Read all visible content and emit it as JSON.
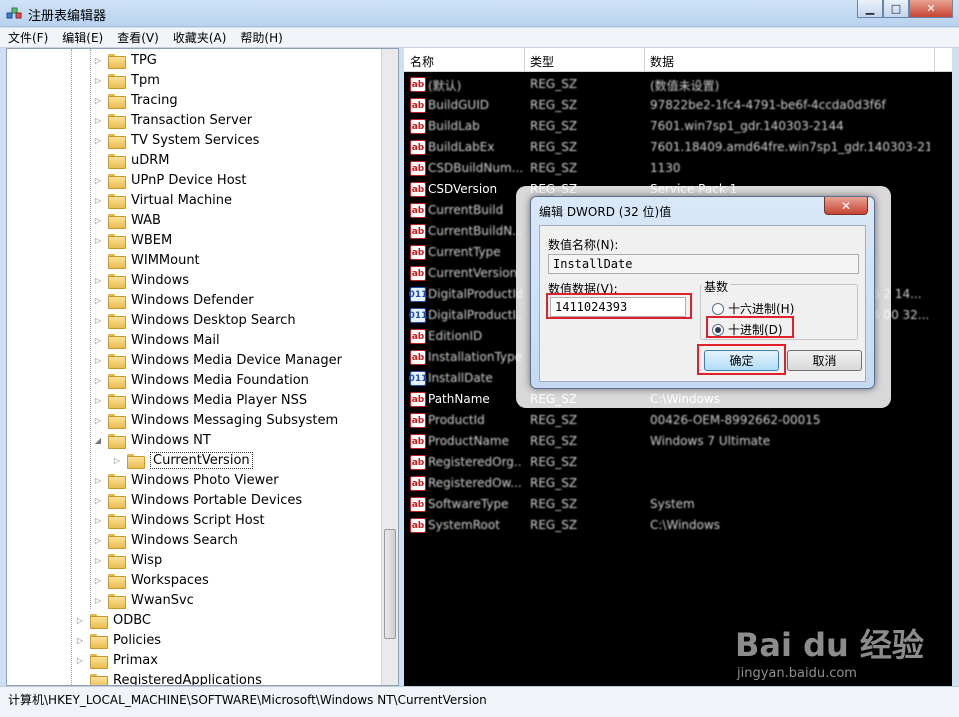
{
  "window": {
    "title": "注册表编辑器",
    "minimize": "▁",
    "maximize": "□",
    "close": "✕"
  },
  "menu": [
    "文件(F)",
    "编辑(E)",
    "查看(V)",
    "收藏夹(A)",
    "帮助(H)"
  ],
  "tree": {
    "items": [
      {
        "label": "TPG",
        "level": 2,
        "expander": "▷"
      },
      {
        "label": "Tpm",
        "level": 2,
        "expander": "▷"
      },
      {
        "label": "Tracing",
        "level": 2,
        "expander": "▷"
      },
      {
        "label": "Transaction Server",
        "level": 2,
        "expander": "▷"
      },
      {
        "label": "TV System Services",
        "level": 2,
        "expander": "▷"
      },
      {
        "label": "uDRM",
        "level": 2,
        "expander": ""
      },
      {
        "label": "UPnP Device Host",
        "level": 2,
        "expander": "▷"
      },
      {
        "label": "Virtual Machine",
        "level": 2,
        "expander": "▷"
      },
      {
        "label": "WAB",
        "level": 2,
        "expander": "▷"
      },
      {
        "label": "WBEM",
        "level": 2,
        "expander": "▷"
      },
      {
        "label": "WIMMount",
        "level": 2,
        "expander": ""
      },
      {
        "label": "Windows",
        "level": 2,
        "expander": "▷"
      },
      {
        "label": "Windows Defender",
        "level": 2,
        "expander": "▷"
      },
      {
        "label": "Windows Desktop Search",
        "level": 2,
        "expander": "▷"
      },
      {
        "label": "Windows Mail",
        "level": 2,
        "expander": "▷"
      },
      {
        "label": "Windows Media Device Manager",
        "level": 2,
        "expander": "▷"
      },
      {
        "label": "Windows Media Foundation",
        "level": 2,
        "expander": "▷"
      },
      {
        "label": "Windows Media Player NSS",
        "level": 2,
        "expander": "▷"
      },
      {
        "label": "Windows Messaging Subsystem",
        "level": 2,
        "expander": "▷"
      },
      {
        "label": "Windows NT",
        "level": 2,
        "expander": "◢"
      },
      {
        "label": "CurrentVersion",
        "level": 3,
        "expander": "▷",
        "selected": true
      },
      {
        "label": "Windows Photo Viewer",
        "level": 2,
        "expander": "▷"
      },
      {
        "label": "Windows Portable Devices",
        "level": 2,
        "expander": "▷"
      },
      {
        "label": "Windows Script Host",
        "level": 2,
        "expander": "▷"
      },
      {
        "label": "Windows Search",
        "level": 2,
        "expander": "▷"
      },
      {
        "label": "Wisp",
        "level": 2,
        "expander": "▷"
      },
      {
        "label": "Workspaces",
        "level": 2,
        "expander": "▷"
      },
      {
        "label": "WwanSvc",
        "level": 2,
        "expander": "▷"
      },
      {
        "label": "ODBC",
        "level": 1,
        "expander": "▷"
      },
      {
        "label": "Policies",
        "level": 1,
        "expander": "▷"
      },
      {
        "label": "Primax",
        "level": 1,
        "expander": "▷"
      },
      {
        "label": "RegisteredApplications",
        "level": 1,
        "expander": ""
      }
    ]
  },
  "list": {
    "headers": [
      "名称",
      "类型",
      "数据"
    ],
    "rows": [
      {
        "icon": "ab",
        "name": "(默认)",
        "type": "REG_SZ",
        "data": "(数值未设置)"
      },
      {
        "icon": "ab",
        "name": "BuildGUID",
        "type": "REG_SZ",
        "data": "97822be2-1fc4-4791-be6f-4ccda0d3f6f"
      },
      {
        "icon": "ab",
        "name": "BuildLab",
        "type": "REG_SZ",
        "data": "7601.win7sp1_gdr.140303-2144"
      },
      {
        "icon": "ab",
        "name": "BuildLabEx",
        "type": "REG_SZ",
        "data": "7601.18409.amd64fre.win7sp1_gdr.140303-21..."
      },
      {
        "icon": "ab",
        "name": "CSDBuildNum...",
        "type": "REG_SZ",
        "data": "1130"
      },
      {
        "icon": "ab",
        "name": "CSDVersion",
        "type": "REG_SZ",
        "data": "Service Pack 1"
      },
      {
        "icon": "ab",
        "name": "CurrentBuild",
        "type": "",
        "data": ""
      },
      {
        "icon": "ab",
        "name": "CurrentBuildN...",
        "type": "",
        "data": ""
      },
      {
        "icon": "ab",
        "name": "CurrentType",
        "type": "",
        "data": ""
      },
      {
        "icon": "ab",
        "name": "CurrentVersion",
        "type": "",
        "data": ""
      },
      {
        "icon": "dw",
        "name": "DigitalProductId",
        "type": "",
        "data": "6 2 14..."
      },
      {
        "icon": "dw",
        "name": "DigitalProductI...",
        "type": "",
        "data": "4 00 32..."
      },
      {
        "icon": "ab",
        "name": "EditionID",
        "type": "",
        "data": ""
      },
      {
        "icon": "ab",
        "name": "InstallationType",
        "type": "",
        "data": ""
      },
      {
        "icon": "dw",
        "name": "InstallDate",
        "type": "",
        "data": ""
      },
      {
        "icon": "ab",
        "name": "PathName",
        "type": "REG_SZ",
        "data": "C:\\Windows"
      },
      {
        "icon": "ab",
        "name": "ProductId",
        "type": "REG_SZ",
        "data": "00426-OEM-8992662-00015"
      },
      {
        "icon": "ab",
        "name": "ProductName",
        "type": "REG_SZ",
        "data": "Windows 7 Ultimate"
      },
      {
        "icon": "ab",
        "name": "RegisteredOrg...",
        "type": "REG_SZ",
        "data": ""
      },
      {
        "icon": "ab",
        "name": "RegisteredOw...",
        "type": "REG_SZ",
        "data": ""
      },
      {
        "icon": "ab",
        "name": "SoftwareType",
        "type": "REG_SZ",
        "data": "System"
      },
      {
        "icon": "ab",
        "name": "SystemRoot",
        "type": "REG_SZ",
        "data": "C:\\Windows"
      }
    ]
  },
  "status": "计算机\\HKEY_LOCAL_MACHINE\\SOFTWARE\\Microsoft\\Windows NT\\CurrentVersion",
  "dialog": {
    "title": "编辑 DWORD (32 位)值",
    "close": "✕",
    "name_label": "数值名称(N):",
    "name_value": "InstallDate",
    "data_label": "数值数据(V):",
    "data_value": "1411024393",
    "base_label": "基数",
    "radio_hex": "十六进制(H)",
    "radio_dec": "十进制(D)",
    "ok": "确定",
    "cancel": "取消"
  },
  "watermark": {
    "logo": "Bai du 经验",
    "url": "jingyan.baidu.com"
  },
  "colors": {
    "highlight": "#e0202a",
    "list_bg": "#000000"
  }
}
